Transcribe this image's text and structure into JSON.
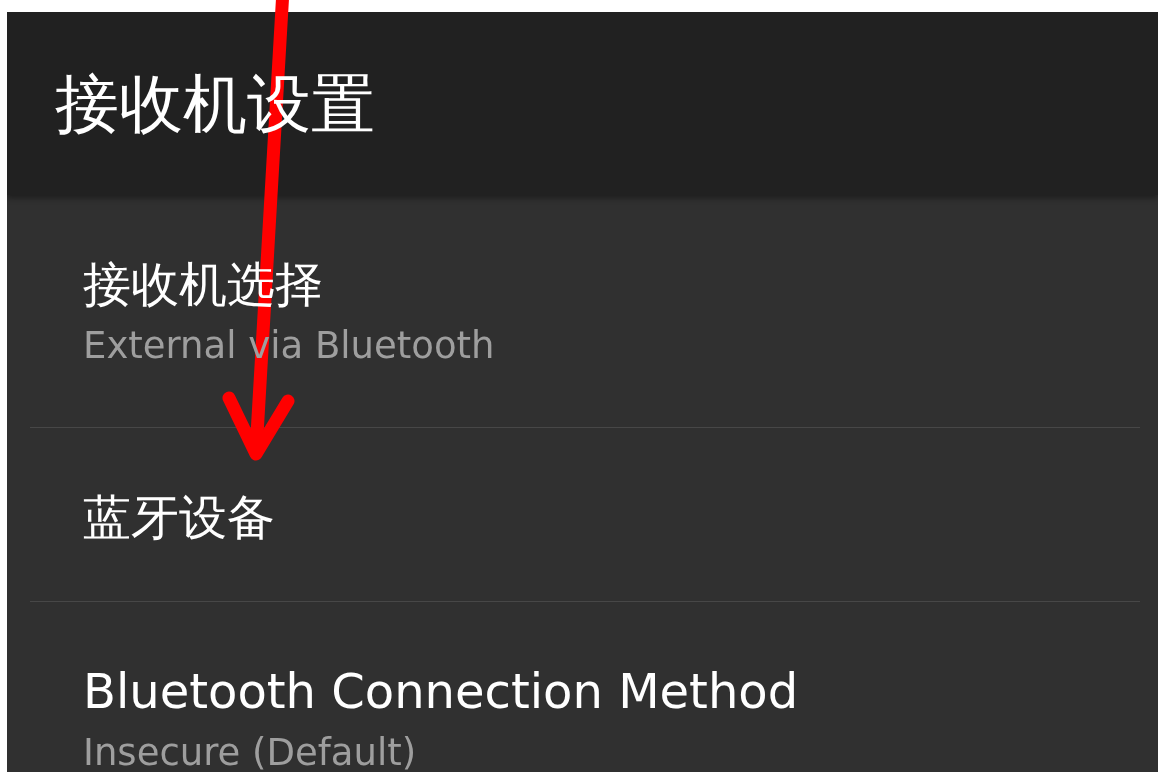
{
  "app_bar": {
    "title": "接收机设置"
  },
  "preferences": [
    {
      "title": "接收机选择",
      "summary": "External via Bluetooth"
    },
    {
      "title": "蓝牙设备"
    },
    {
      "title": "Bluetooth Connection Method",
      "summary": "Insecure (Default)"
    }
  ],
  "annotations": [
    {
      "kind": "arrow"
    }
  ]
}
